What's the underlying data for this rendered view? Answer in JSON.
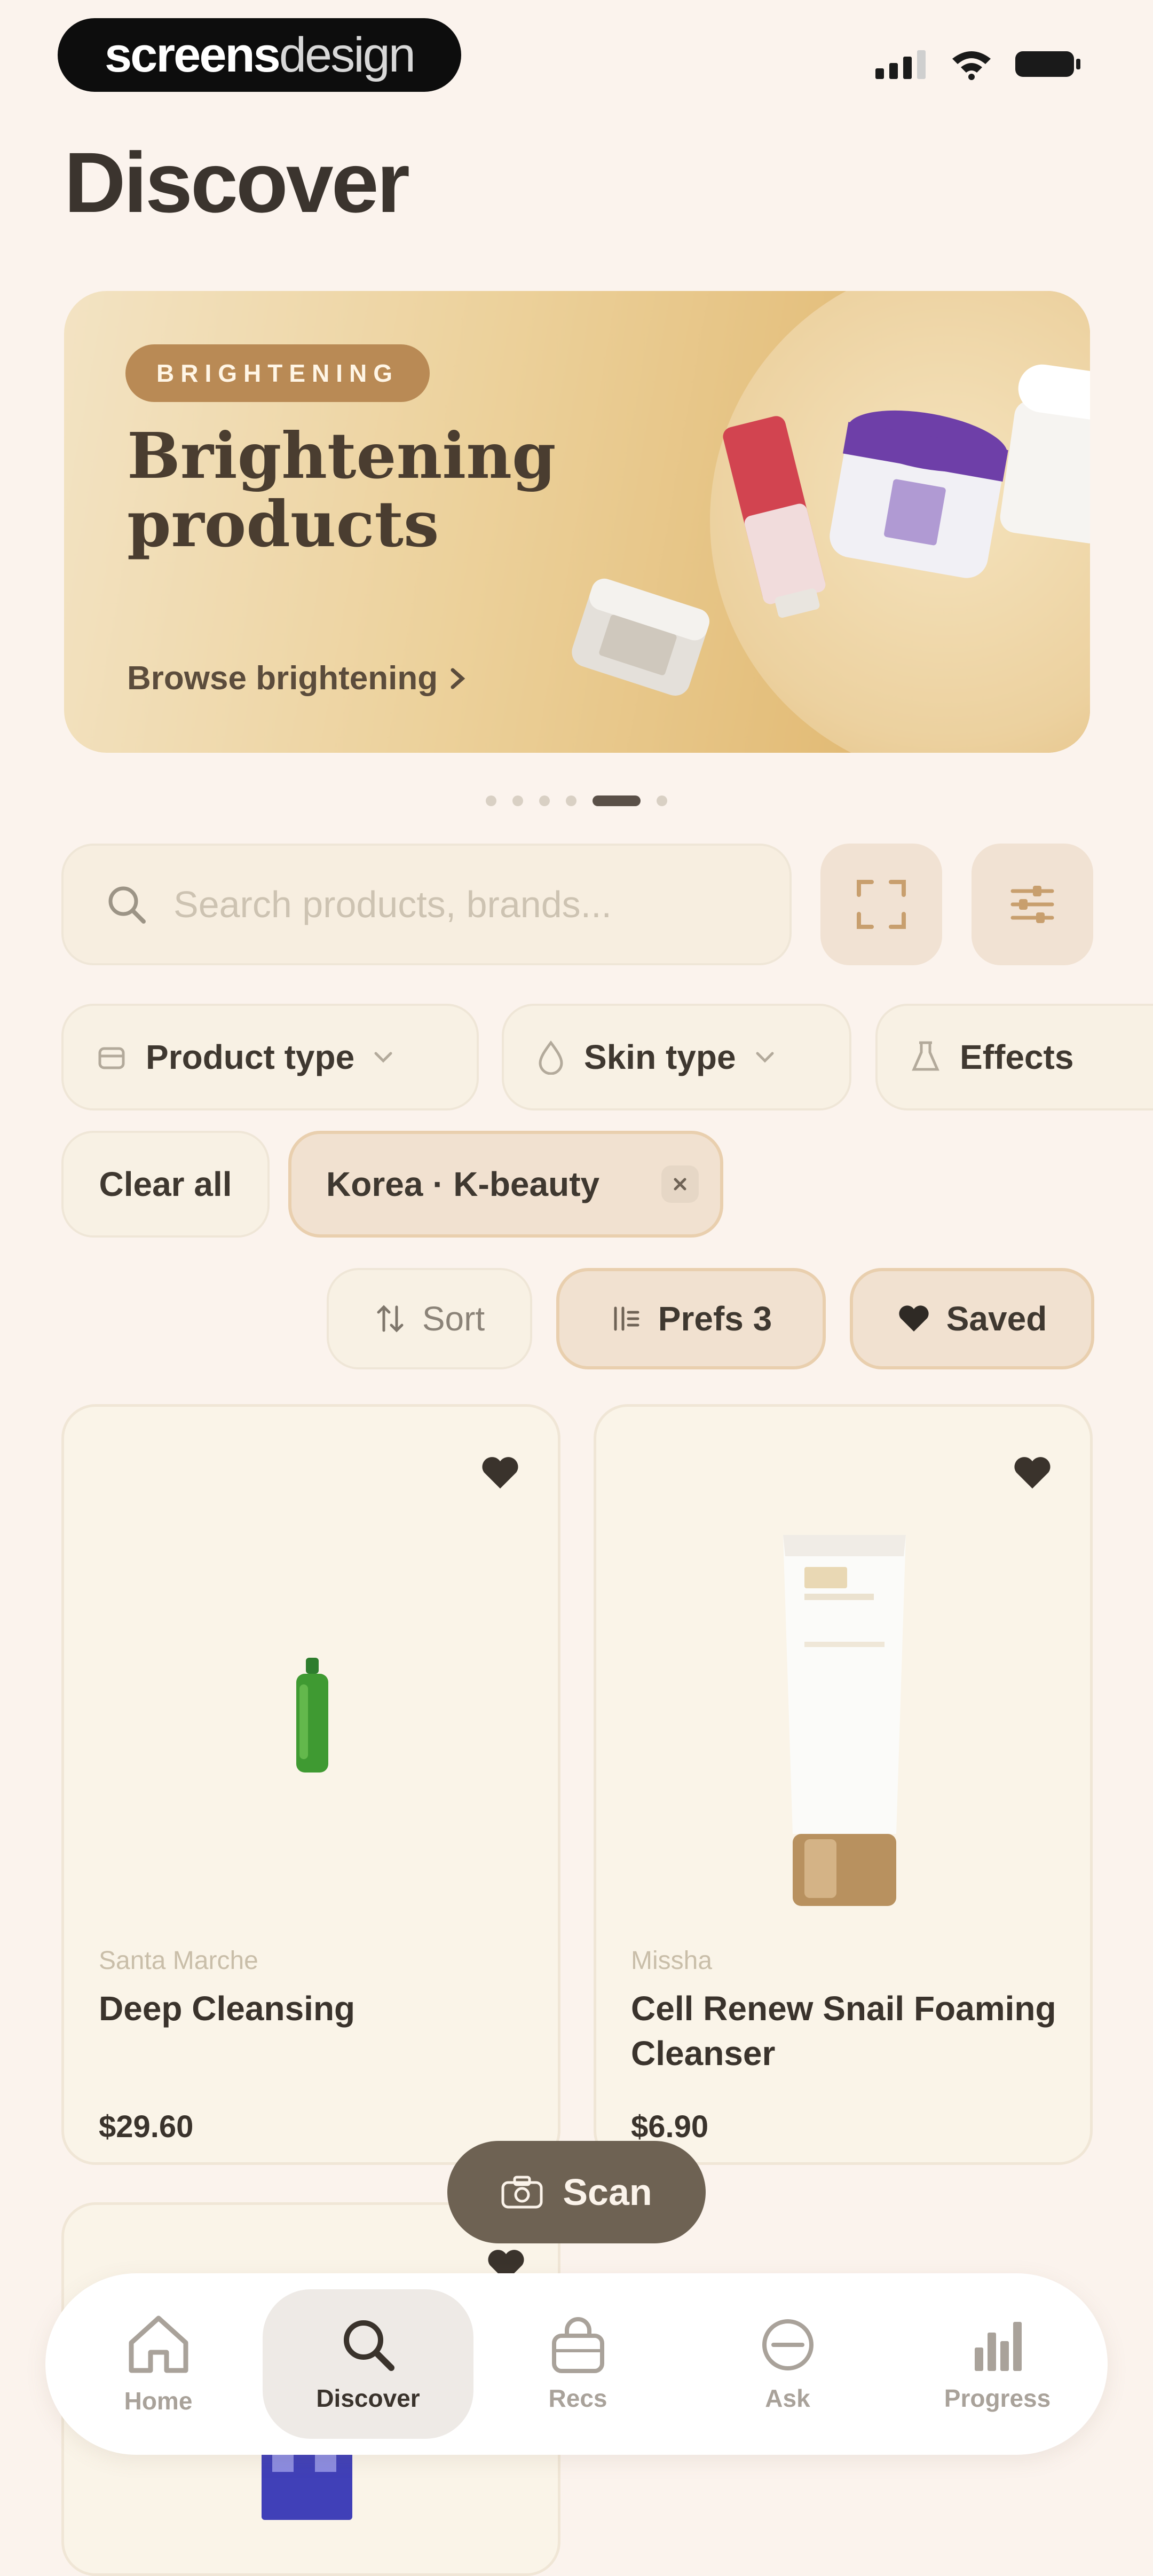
{
  "status_bar": {
    "brand_bold": "screens",
    "brand_light": "design"
  },
  "page": {
    "title": "Discover"
  },
  "hero": {
    "badge": "BRIGHTENING",
    "title": "Brightening products",
    "link": "Browse brightening",
    "carousel": {
      "count": 6,
      "active_index": 4
    }
  },
  "search": {
    "placeholder": "Search products, brands..."
  },
  "filters": {
    "product_type": "Product type",
    "skin_type": "Skin type",
    "effects": "Effects",
    "clear_all": "Clear all",
    "active_filter": "Korea · K-beauty"
  },
  "toolbar": {
    "sort": "Sort",
    "prefs": "Prefs 3",
    "saved": "Saved"
  },
  "products": [
    {
      "brand": "Santa Marche",
      "name": "Deep Cleansing",
      "price": "$29.60"
    },
    {
      "brand": "Missha",
      "name": "Cell Renew Snail Foaming Cleanser",
      "price": "$6.90"
    }
  ],
  "scan_button": "Scan",
  "tabs": [
    {
      "label": "Home"
    },
    {
      "label": "Discover"
    },
    {
      "label": "Recs"
    },
    {
      "label": "Ask"
    },
    {
      "label": "Progress"
    }
  ],
  "colors": {
    "background": "#fbf3ed",
    "accent_brown": "#b98a55",
    "scan_button": "#6e6253",
    "heart": "#3a332c"
  }
}
